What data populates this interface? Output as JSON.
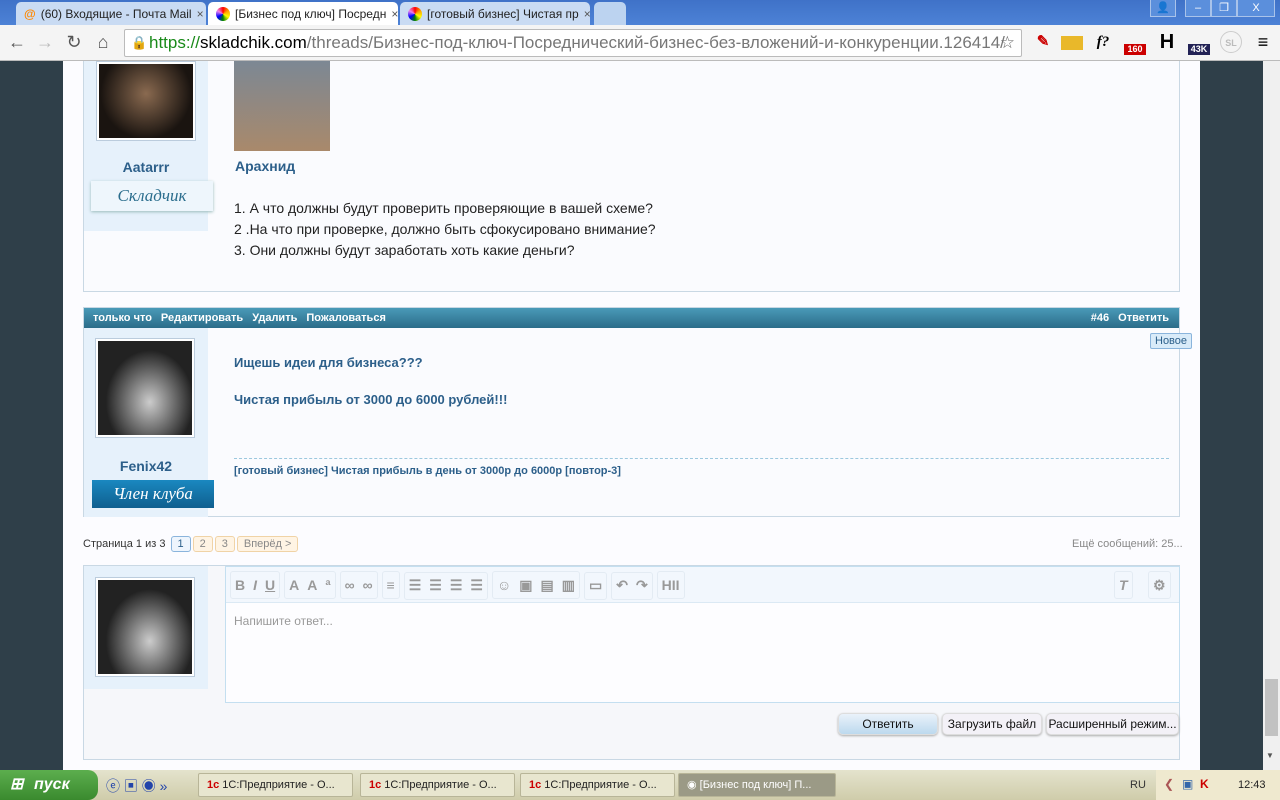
{
  "browser": {
    "tabs": [
      {
        "label": "(60) Входящие - Почта Mail"
      },
      {
        "label": "[Бизнес под ключ] Посредн"
      },
      {
        "label": "[готовый бизнес] Чистая пр"
      }
    ],
    "url": {
      "scheme": "https://",
      "domain": "skladchik.com",
      "path": "/threads/Бизнес-под-ключ-Посреднический-бизнес-без-вложений-и-конкуренции.126414/"
    },
    "extensions": [
      "f?",
      "H",
      "160",
      "43K",
      "SL"
    ]
  },
  "post1": {
    "username": "Aatarrr",
    "rank": "Складчик",
    "image_caption": "Арахнид",
    "lines": [
      "1. А что должны будут проверить проверяющие в вашей схеме?",
      "2 .На что при проверке, должно быть сфокусировано внимание?",
      "3. Они должны будут заработать хоть какие деньги?"
    ]
  },
  "post2": {
    "time": "только что",
    "edit": "Редактировать",
    "delete": "Удалить",
    "report": "Пожаловаться",
    "number": "#46",
    "reply": "Ответить",
    "new_badge": "Новое",
    "username": "Fenix42",
    "rank": "Член клуба",
    "line1": "Ищешь идеи для бизнеса???",
    "line2": "Чистая прибыль от 3000 до 6000 рублей!!!",
    "signature": "[готовый бизнес] Чистая прибыль в день от 3000р до 6000р [повтор-3]"
  },
  "pagination": {
    "label": "Страница 1 из 3",
    "pages": [
      "1",
      "2",
      "3"
    ],
    "next": "Вперёд >",
    "more": "Ещё сообщений: 25..."
  },
  "editor": {
    "placeholder": "Напишите ответ...",
    "reply": "Ответить",
    "upload": "Загрузить файл",
    "advanced": "Расширенный режим..."
  },
  "taskbar": {
    "start": "пуск",
    "tasks": [
      "1С:Предприятие - О...",
      "1С:Предприятие - О...",
      "1С:Предприятие - О...",
      "[Бизнес под ключ] П..."
    ],
    "lang": "RU",
    "clock": "12:43"
  }
}
